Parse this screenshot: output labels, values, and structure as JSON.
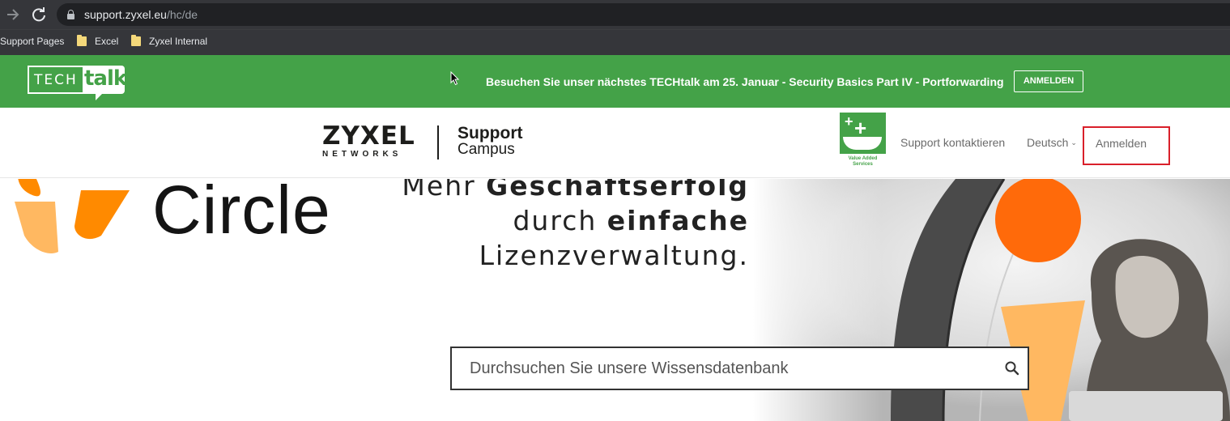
{
  "browser": {
    "back_icon": "arrow-right-icon",
    "reload_icon": "reload-icon",
    "url_host": "support.zyxel.eu",
    "url_path": "/hc/de",
    "bookmarks": [
      "Support Pages",
      "Excel",
      "Zyxel Internal"
    ]
  },
  "promo": {
    "logo_tech": "TECH",
    "logo_talk": "talk",
    "text": "Besuchen Sie unser nächstes TECHtalk am 25. Januar - Security Basics Part IV - Portforwarding",
    "button_label": "ANMELDEN"
  },
  "header": {
    "brand_main": "ZYXEL",
    "brand_sub": "NETWORKS",
    "campus_line1": "Support",
    "campus_line2": "Campus",
    "vas_label_line1": "Value Added",
    "vas_label_line2": "Services",
    "contact_label": "Support kontaktieren",
    "language": "Deutsch",
    "login_label": "Anmelden"
  },
  "hero": {
    "brand_word": "Circle",
    "slogan_line1_light": "Mehr ",
    "slogan_line1_bold": "Geschäftserfolg",
    "slogan_line2_light": "durch ",
    "slogan_line2_bold": "einfache",
    "slogan_line3": "Lizenzverwaltung."
  },
  "search": {
    "placeholder": "Durchsuchen Sie unsere Wissensdatenbank"
  },
  "colors": {
    "brand_green": "#44a248",
    "highlight_red": "#d9202a",
    "circle_orange": "#ff8a00",
    "circle_light_orange": "#ffb861"
  }
}
